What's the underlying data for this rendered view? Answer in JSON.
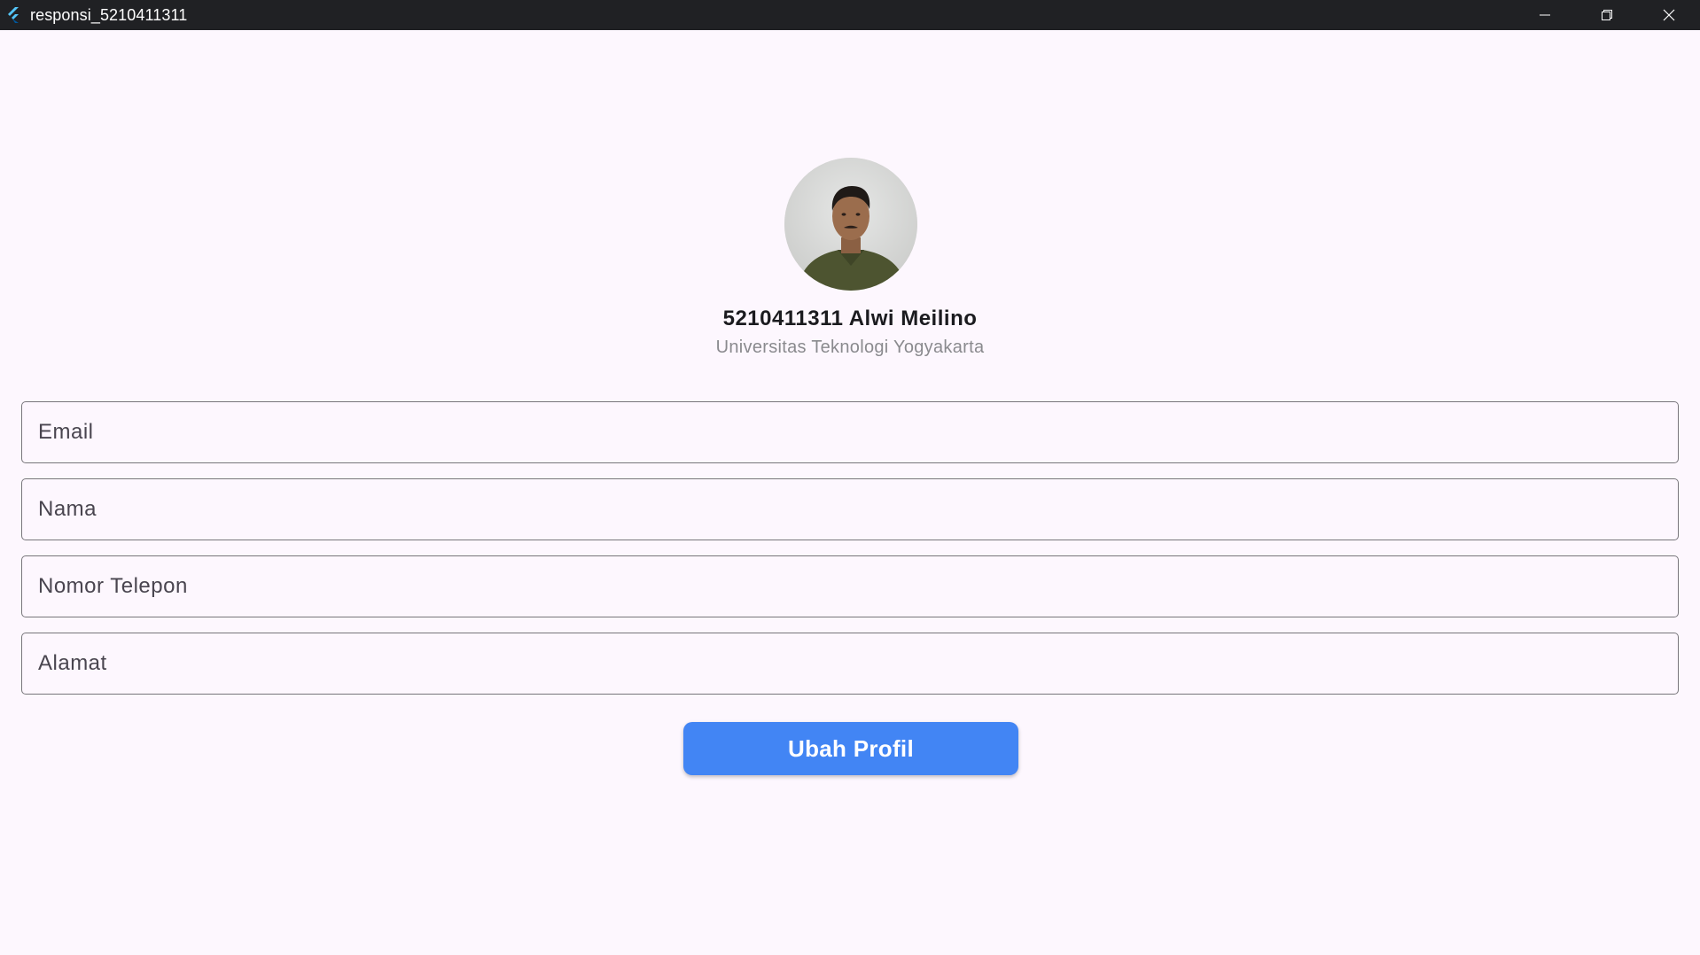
{
  "window": {
    "title": "responsi_5210411311",
    "icons": {
      "app": "flutter-logo-icon",
      "minimize": "minimize-icon",
      "restore": "restore-icon",
      "close": "close-icon"
    }
  },
  "profile": {
    "avatar": "avatar-photo",
    "name": "5210411311 Alwi Meilino",
    "institution": "Universitas Teknologi Yogyakarta"
  },
  "form": {
    "email": {
      "placeholder": "Email",
      "value": ""
    },
    "nama": {
      "placeholder": "Nama",
      "value": ""
    },
    "telepon": {
      "placeholder": "Nomor Telepon",
      "value": ""
    },
    "alamat": {
      "placeholder": "Alamat",
      "value": ""
    },
    "submit_label": "Ubah Profil"
  },
  "colors": {
    "background": "#fdf7fe",
    "titlebar": "#202124",
    "button": "#4285f4",
    "field_border": "#77767a"
  }
}
